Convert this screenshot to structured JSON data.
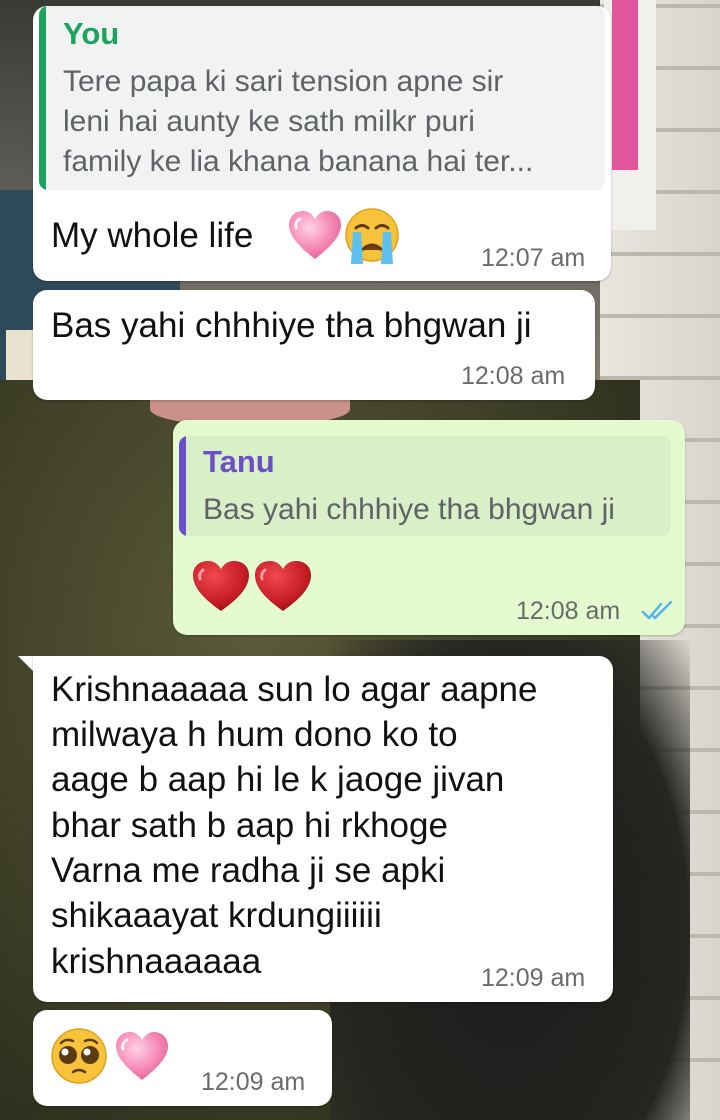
{
  "messages": [
    {
      "direction": "incoming",
      "quote": {
        "sender": "You",
        "text_lines": [
          "Tere papa ki sari tension apne sir",
          "leni hai aunty ke sath milkr puri",
          "family ke lia khana banana hai ter..."
        ],
        "accent": "#1ea35e"
      },
      "text": "My whole life",
      "emojis": [
        "pink-heart-icon",
        "crying-face-icon"
      ],
      "time": "12:07 am"
    },
    {
      "direction": "incoming",
      "text": "Bas yahi chhhiye tha bhgwan ji",
      "time": "12:08 am"
    },
    {
      "direction": "outgoing",
      "quote": {
        "sender": "Tanu",
        "text_lines": [
          "Bas yahi chhhiye tha bhgwan ji"
        ],
        "accent": "#6a4fc7"
      },
      "emojis": [
        "red-heart-icon",
        "red-heart-icon"
      ],
      "time": "12:08 am",
      "status": "double-tick-read-icon"
    },
    {
      "direction": "incoming",
      "text_lines": [
        "Krishnaaaaa sun lo agar aapne",
        "milwaya h hum dono ko to",
        "aage b aap hi le k jaoge jivan",
        "bhar sath b aap hi rkhoge",
        "Varna me radha ji se apki",
        "shikaaayat krdungiiiiii",
        "krishnaaaaaa"
      ],
      "time": "12:09 am"
    },
    {
      "direction": "incoming",
      "emojis": [
        "pleading-face-icon",
        "pink-heart-icon"
      ],
      "time": "12:09 am"
    }
  ],
  "colors": {
    "incoming_bubble": "#ffffff",
    "outgoing_bubble": "#e4fbcf",
    "read_tick": "#4fb6ec",
    "quote_incoming_bg": "#f1f2f2",
    "quote_outgoing_bg": "#d8efc7"
  }
}
